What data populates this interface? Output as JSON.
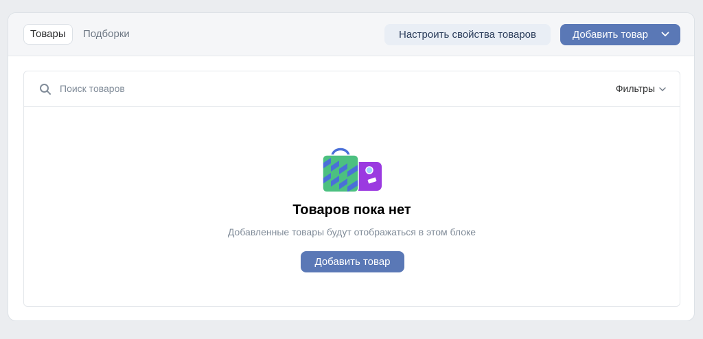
{
  "tabs": [
    {
      "label": "Товары",
      "active": true
    },
    {
      "label": "Подборки",
      "active": false
    }
  ],
  "header": {
    "configure_button": "Настроить свойства товаров",
    "add_button": "Добавить товар"
  },
  "search": {
    "placeholder": "Поиск товаров",
    "value": ""
  },
  "filters": {
    "label": "Фильтры"
  },
  "empty_state": {
    "title": "Товаров пока нет",
    "subtitle": "Добавленные товары будут отображаться в этом блоке",
    "button": "Добавить товар"
  },
  "colors": {
    "accent": "#5a78b6",
    "secondary_button_bg": "#e9eef5",
    "muted_text": "#818c99",
    "page_bg": "#ebedf0"
  },
  "icons": {
    "search": "search-icon",
    "dropdown": "chevron-down-icon",
    "illustration": "shopping-bag-icon"
  }
}
